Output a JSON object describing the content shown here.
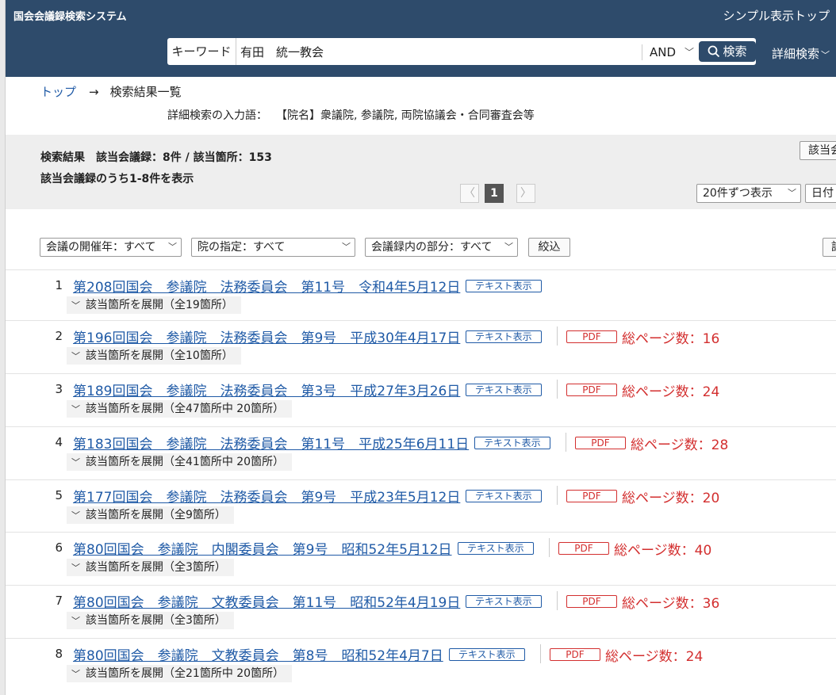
{
  "header": {
    "site_title": "国会会議録検索システム",
    "simple_top": "シンプル表示トップ",
    "keyword_label": "キーワード",
    "keyword_value": "有田　統一教会",
    "operator": "AND",
    "search_button": "検索",
    "advanced_search": "詳細検索"
  },
  "breadcrumb": {
    "top": "トップ",
    "arrow": "→",
    "current": "検索結果一覧"
  },
  "advanced_input": {
    "label": "詳細検索の入力語：",
    "value": "【院名】衆議院, 参議院, 両院協議会・合同審査会等"
  },
  "summary": {
    "count_text": "検索結果　該当会議録：8件 / 該当箇所：153",
    "range_text": "該当会議録のうち1-8件を表示",
    "right_button": "該当会",
    "per_page": "20件ずつ表示",
    "sort": "日付"
  },
  "pagination": {
    "prev": "〈",
    "current": "1",
    "next": "〉"
  },
  "filters": {
    "year": "会議の開催年：すべて",
    "house": "院の指定：すべて",
    "part": "会議録内の部分：すべて",
    "apply": "絞込",
    "right_button": "記"
  },
  "labels": {
    "text_view": "テキスト表示",
    "pdf": "PDF"
  },
  "results": [
    {
      "num": "1",
      "title": "第208回国会　参議院　法務委員会　第11号　令和4年5月12日",
      "pages": "",
      "expand": "該当箇所を展開（全19箇所）"
    },
    {
      "num": "2",
      "title": "第196回国会　参議院　法務委員会　第9号　平成30年4月17日",
      "pages": "総ページ数：16",
      "expand": "該当箇所を展開（全10箇所）"
    },
    {
      "num": "3",
      "title": "第189回国会　参議院　法務委員会　第3号　平成27年3月26日",
      "pages": "総ページ数：24",
      "expand": "該当箇所を展開（全47箇所中 20箇所）"
    },
    {
      "num": "4",
      "title": "第183回国会　参議院　法務委員会　第11号　平成25年6月11日",
      "pages": "総ページ数：28",
      "expand": "該当箇所を展開（全41箇所中 20箇所）"
    },
    {
      "num": "5",
      "title": "第177回国会　参議院　法務委員会　第9号　平成23年5月12日",
      "pages": "総ページ数：20",
      "expand": "該当箇所を展開（全9箇所）"
    },
    {
      "num": "6",
      "title": "第80回国会　参議院　内閣委員会　第9号　昭和52年5月12日",
      "pages": "総ページ数：40",
      "expand": "該当箇所を展開（全3箇所）"
    },
    {
      "num": "7",
      "title": "第80回国会　参議院　文教委員会　第11号　昭和52年4月19日",
      "pages": "総ページ数：36",
      "expand": "該当箇所を展開（全3箇所）"
    },
    {
      "num": "8",
      "title": "第80回国会　参議院　文教委員会　第8号　昭和52年4月7日",
      "pages": "総ページ数：24",
      "expand": "該当箇所を展開（全21箇所中 20箇所）"
    }
  ]
}
